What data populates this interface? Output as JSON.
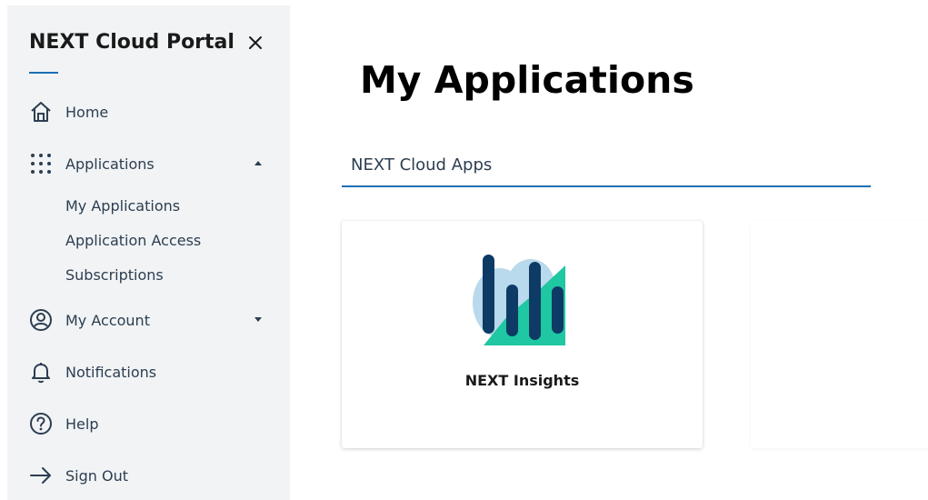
{
  "sidebar": {
    "brand": "NEXT Cloud Portal",
    "items": [
      {
        "label": "Home",
        "icon": "home-icon"
      },
      {
        "label": "Applications",
        "icon": "grid-icon",
        "expanded": true,
        "subitems": [
          "My Applications",
          "Application Access",
          "Subscriptions"
        ]
      },
      {
        "label": "My Account",
        "icon": "user-circle-icon",
        "expanded": false
      },
      {
        "label": "Notifications",
        "icon": "bell-icon"
      },
      {
        "label": "Help",
        "icon": "help-circle-icon"
      },
      {
        "label": "Sign Out",
        "icon": "arrow-right-icon"
      }
    ]
  },
  "main": {
    "title": "My Applications",
    "filter": "NEXT Cloud Apps",
    "cards": [
      {
        "name": "NEXT Insights",
        "icon": "next-insights-logo-icon"
      }
    ]
  },
  "colors": {
    "accent": "#1b6fb4",
    "sidebar_bg": "#f1f3f5",
    "logo_navy": "#0d3b66",
    "logo_teal": "#1fc7a2",
    "logo_lightblue": "#b9d9ec"
  }
}
